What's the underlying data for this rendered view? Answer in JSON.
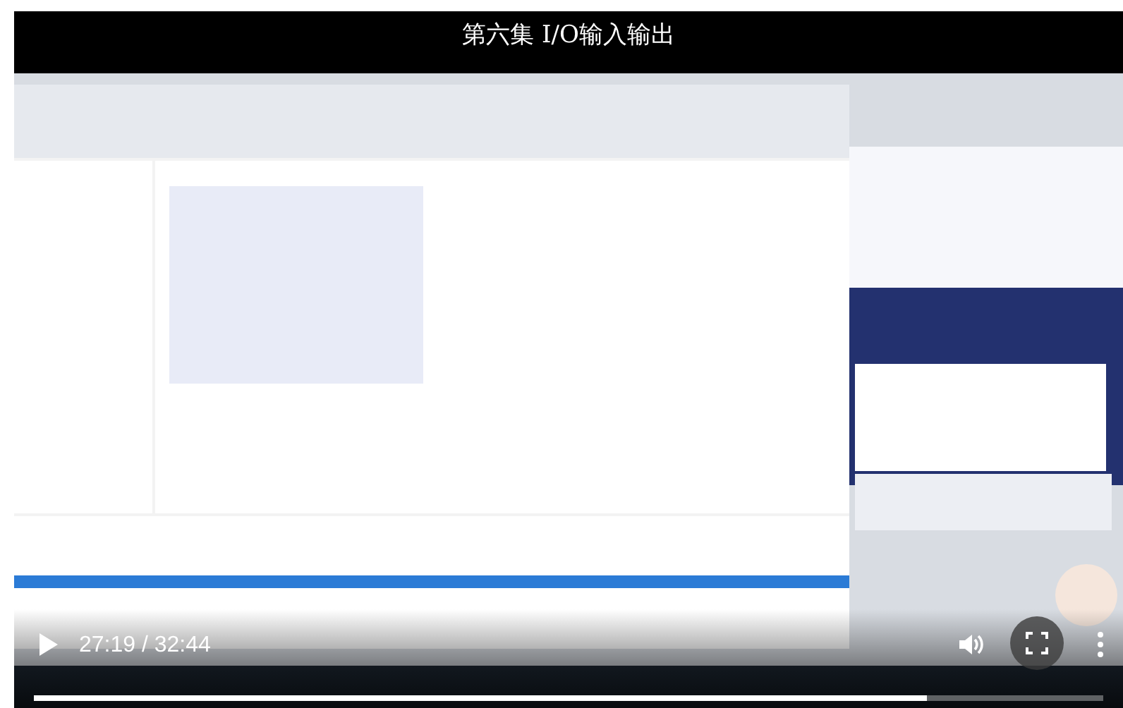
{
  "title": "第六集 I/O输入输出",
  "controls": {
    "playing": false,
    "time": "27:19 / 32:44",
    "progress": {
      "level": 0.835
    }
  }
}
